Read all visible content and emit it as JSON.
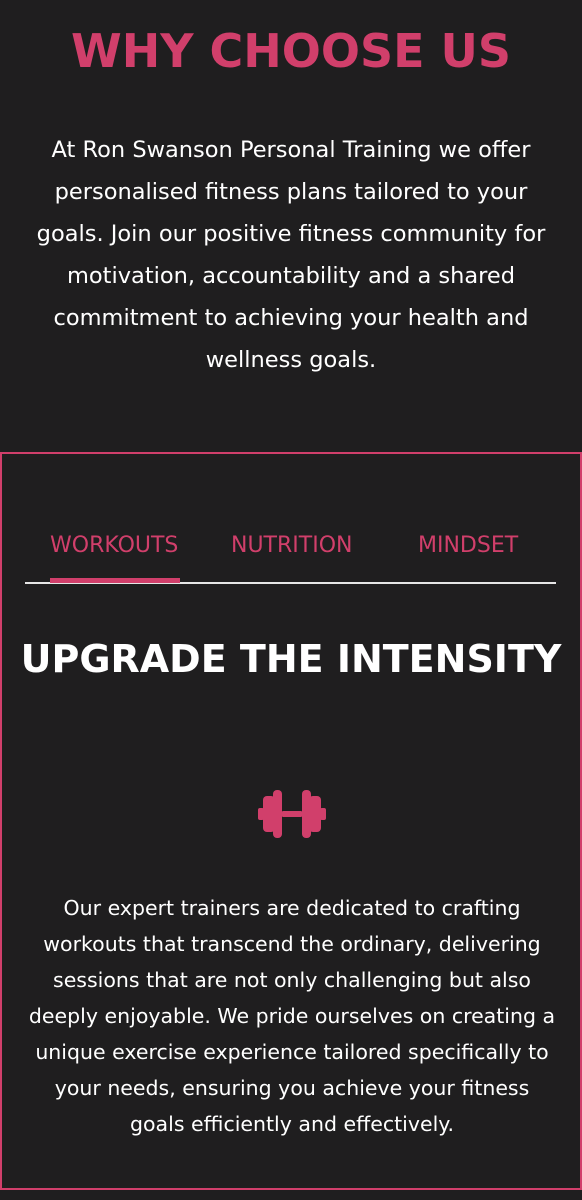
{
  "header": {
    "title": "WHY CHOOSE US",
    "intro": "At Ron Swanson Personal Training we offer personalised fitness plans tailored to your goals. Join our positive fitness community for motivation, accountability and a shared commitment to achieving your health and wellness goals."
  },
  "tabs": {
    "items": [
      {
        "label": "WORKOUTS"
      },
      {
        "label": "NUTRITION"
      },
      {
        "label": "MINDSET"
      }
    ],
    "active": "WORKOUTS"
  },
  "panel": {
    "title": "UPGRADE THE INTENSITY",
    "icon": "dumbbell-icon",
    "body": "Our expert trainers are dedicated to crafting workouts that transcend the ordinary, delivering sessions that are not only challenging but also deeply enjoyable. We pride ourselves on creating a unique exercise experience tailored specifically to your needs, ensuring you achieve your fitness goals efficiently and effectively."
  },
  "colors": {
    "background": "#1f1e1f",
    "accent": "#d13f6b",
    "text": "#ffffff",
    "divider": "#e6e6e6"
  }
}
